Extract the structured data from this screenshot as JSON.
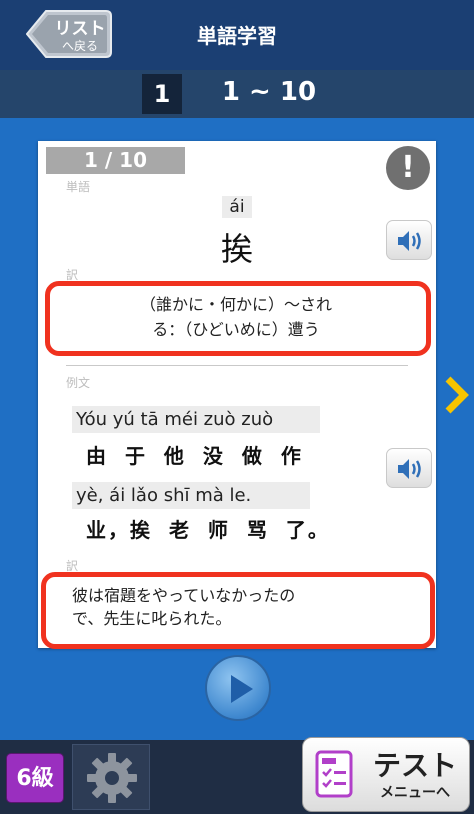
{
  "header": {
    "title": "単語学習",
    "back_label_1": "リスト",
    "back_label_2": "へ戻る"
  },
  "subheader": {
    "set_number": "1",
    "range": "1 ~ 10"
  },
  "card": {
    "counter": "1 / 10",
    "word_label": "単語",
    "pinyin": "ái",
    "word": "挨",
    "meaning_label": "訳",
    "meaning_line1": "（誰かに・何かに）～され",
    "meaning_line2": "る：（ひどいめに）遭う",
    "example_label": "例文",
    "example_pinyin_1": "Yóu yú tā méi zuò zuò",
    "example_hanzi_1": "由 于 他 没 做 作",
    "example_pinyin_2": "yè, ái lǎo shī mà le.",
    "example_hanzi_2": "业，挨 老 师 骂 了。",
    "translation_label": "訳",
    "translation_line1": "彼は宿題をやっていなかったの",
    "translation_line2": "で、先生に叱られた。",
    "alert_icon_glyph": "!"
  },
  "footer": {
    "grade": "6級",
    "test_label": "テスト",
    "test_sublabel": "メニューへ"
  },
  "colors": {
    "background": "#1f6fc4",
    "header": "#1b3f73",
    "highlight_border": "#f0321f",
    "next_arrow": "#f6c400",
    "grade": "#9a2fbf"
  }
}
